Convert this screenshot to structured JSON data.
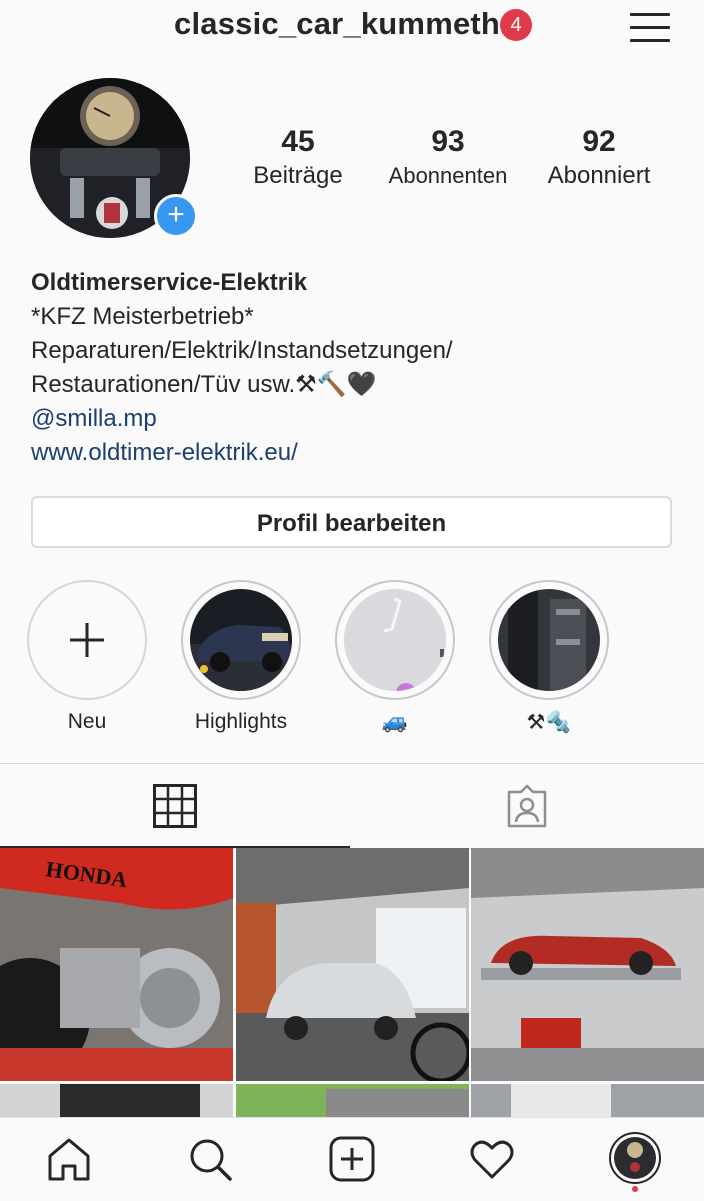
{
  "header": {
    "username": "classic_car_kummeth",
    "notification_count": "4",
    "menu_icon": "hamburger-menu-icon"
  },
  "profile": {
    "stats": [
      {
        "value": "45",
        "label": "Beiträge"
      },
      {
        "value": "93",
        "label": "Abonnenten"
      },
      {
        "value": "92",
        "label": "Abonniert"
      }
    ],
    "name": "Oldtimerservice-Elektrik",
    "bio_lines": [
      "*KFZ Meisterbetrieb*",
      "Reparaturen/Elektrik/Instandsetzungen/",
      "Restaurationen/Tüv usw.⚒🔨🖤"
    ],
    "mention": "@smilla.mp",
    "website": "www.oldtimer-elektrik.eu/",
    "edit_button": "Profil bearbeiten"
  },
  "highlights": [
    {
      "label": "Neu"
    },
    {
      "label": "Highlights"
    },
    {
      "label": "🚙"
    },
    {
      "label": "⚒🔩"
    }
  ],
  "tabs": [
    {
      "icon": "grid-icon",
      "active": true
    },
    {
      "icon": "tagged-person-icon",
      "active": false
    }
  ],
  "bottom_nav": [
    {
      "icon": "home-icon"
    },
    {
      "icon": "search-icon"
    },
    {
      "icon": "add-post-icon"
    },
    {
      "icon": "heart-icon"
    },
    {
      "icon": "profile-avatar-icon"
    }
  ],
  "colors": {
    "accent_blue": "#3897f0",
    "badge_red": "#e03b4a",
    "link_blue": "#1b3f6e"
  }
}
